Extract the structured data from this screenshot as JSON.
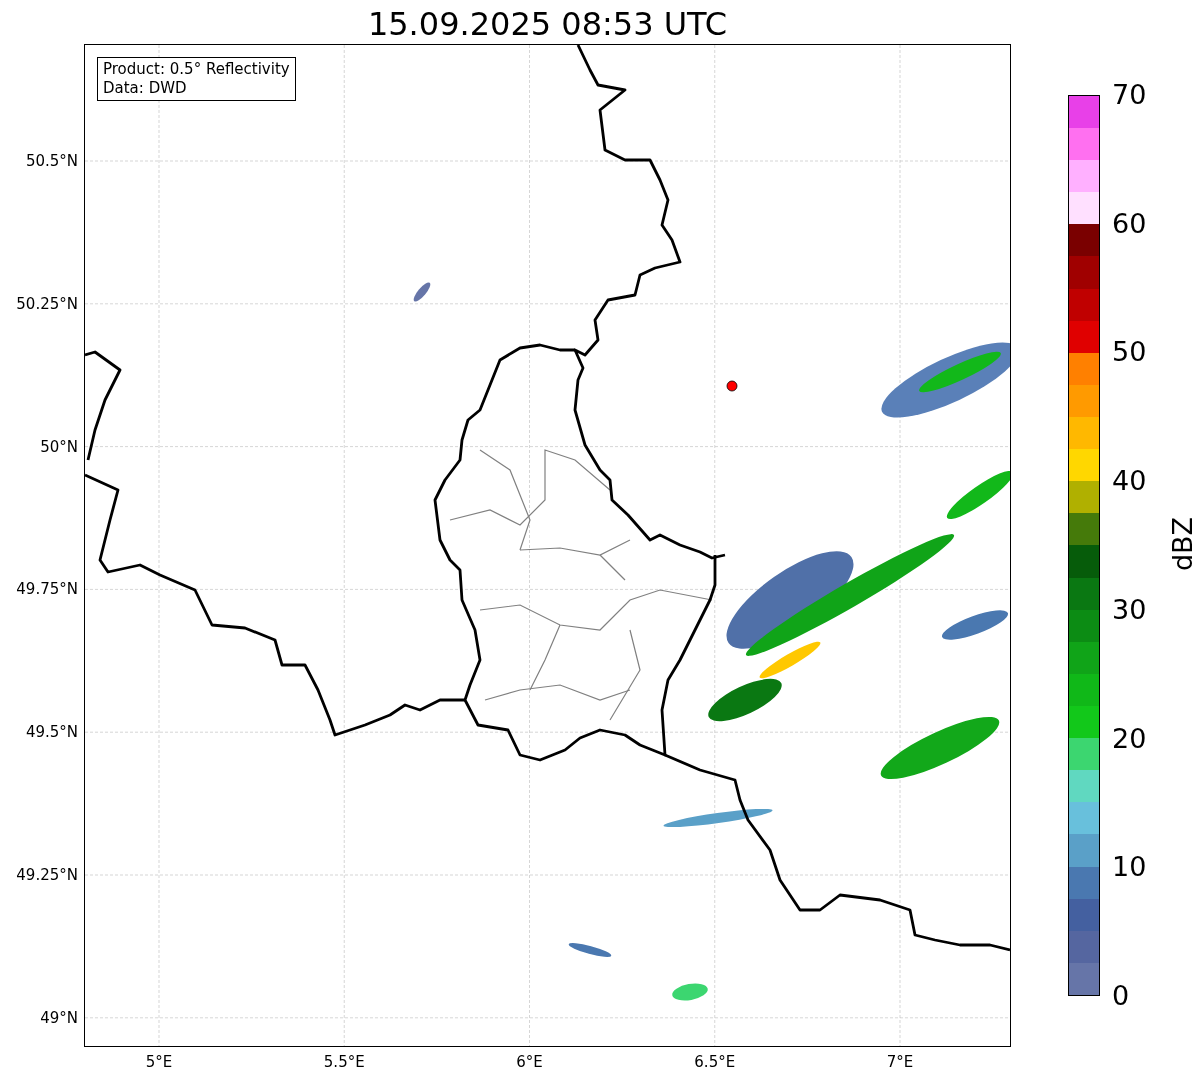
{
  "title": "15.09.2025 08:53 UTC",
  "legend": [
    "Product: 0.5° Reflectivity",
    "Data: DWD"
  ],
  "lat_ticks": [
    "50.5°N",
    "50.25°N",
    "50°N",
    "49.75°N",
    "49.5°N",
    "49.25°N",
    "49°N"
  ],
  "lon_ticks": [
    "5°E",
    "5.5°E",
    "6°E",
    "6.5°E",
    "7°E"
  ],
  "colorbar": {
    "label": "dBZ",
    "ticks": [
      "70",
      "60",
      "50",
      "40",
      "30",
      "20",
      "10",
      "0"
    ],
    "bands": [
      {
        "color": "#6675a8"
      },
      {
        "color": "#5566a0"
      },
      {
        "color": "#4460a0"
      },
      {
        "color": "#4a78b0"
      },
      {
        "color": "#5aa0c8"
      },
      {
        "color": "#68c0dc"
      },
      {
        "color": "#60d8c0"
      },
      {
        "color": "#3cd670"
      },
      {
        "color": "#12c81a"
      },
      {
        "color": "#10b818"
      },
      {
        "color": "#10a418"
      },
      {
        "color": "#0c8c14"
      },
      {
        "color": "#0a7812"
      },
      {
        "color": "#065c0a"
      },
      {
        "color": "#457a0a"
      },
      {
        "color": "#b0b000"
      },
      {
        "color": "#ffd700"
      },
      {
        "color": "#ffb800"
      },
      {
        "color": "#ff9a00"
      },
      {
        "color": "#ff8000"
      },
      {
        "color": "#e00000"
      },
      {
        "color": "#c00000"
      },
      {
        "color": "#a00000"
      },
      {
        "color": "#7a0000"
      },
      {
        "color": "#ffe0ff"
      },
      {
        "color": "#ffb0ff"
      },
      {
        "color": "#ff70f0"
      },
      {
        "color": "#e840e8"
      }
    ]
  }
}
